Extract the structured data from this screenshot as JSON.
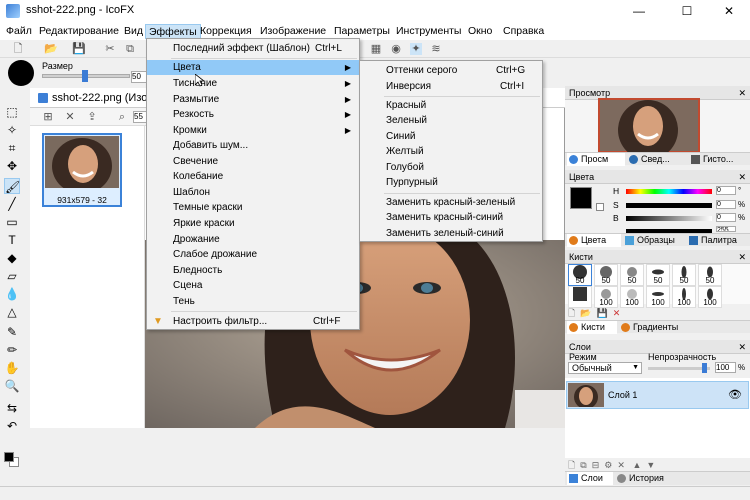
{
  "window": {
    "title": "sshot-222.png - IcoFX",
    "minimize": "—",
    "maximize": "☐",
    "close": "✕"
  },
  "menubar": [
    "Файл",
    "Редактирование",
    "Вид",
    "Эффекты",
    "Коррекция",
    "Изображение",
    "Параметры",
    "Инструменты",
    "Окно",
    "Справка"
  ],
  "options": {
    "size_label": "Размер",
    "size_value": "50",
    "size_fraction": 0.45
  },
  "document": {
    "title": "sshot-222.png (Изоб",
    "zoom_field": "55",
    "thumbnail_label": "931x579 - 32"
  },
  "effects_menu": {
    "items": [
      {
        "label": "Последний эффект (Шаблон)",
        "shortcut": "Ctrl+L"
      },
      {
        "label": "Цвета",
        "submenu": true,
        "highlighted": true
      },
      {
        "label": "Тиснение",
        "submenu": true
      },
      {
        "label": "Размытие",
        "submenu": true
      },
      {
        "label": "Резкость",
        "submenu": true
      },
      {
        "label": "Кромки",
        "submenu": true
      },
      {
        "label": "Добавить шум..."
      },
      {
        "label": "Свечение"
      },
      {
        "label": "Колебание"
      },
      {
        "label": "Шаблон"
      },
      {
        "label": "Темные краски"
      },
      {
        "label": "Яркие краски"
      },
      {
        "label": "Дрожание"
      },
      {
        "label": "Слабое дрожание"
      },
      {
        "label": "Бледность"
      },
      {
        "label": "Сцена"
      },
      {
        "label": "Тень"
      },
      {
        "label": "Настроить фильтр...",
        "shortcut": "Ctrl+F"
      }
    ]
  },
  "colors_submenu": {
    "items": [
      {
        "label": "Оттенки серого",
        "shortcut": "Ctrl+G"
      },
      {
        "label": "Инверсия",
        "shortcut": "Ctrl+I"
      },
      {
        "label": "Красный"
      },
      {
        "label": "Зеленый"
      },
      {
        "label": "Синий"
      },
      {
        "label": "Желтый"
      },
      {
        "label": "Голубой"
      },
      {
        "label": "Пурпурный"
      },
      {
        "label": "Заменить красный-зеленый"
      },
      {
        "label": "Заменить красный-синий"
      },
      {
        "label": "Заменить зеленый-синий"
      }
    ]
  },
  "preview_panel": {
    "title": "Просмотр",
    "tabs": [
      "Просм",
      "Свед...",
      "Гисто..."
    ]
  },
  "colors_panel": {
    "title": "Цвета",
    "channels": [
      {
        "label": "H",
        "value": "0",
        "unit": "°"
      },
      {
        "label": "S",
        "value": "0",
        "unit": "%"
      },
      {
        "label": "B",
        "value": "0",
        "unit": "%"
      },
      {
        "label": "",
        "value": "255",
        "unit": ""
      }
    ],
    "tabs": [
      "Цвета",
      "Образцы",
      "Палитра"
    ]
  },
  "brushes_panel": {
    "title": "Кисти",
    "sizes": [
      "50",
      "50",
      "50",
      "50",
      "50",
      "50",
      "",
      "100",
      "100",
      "100",
      "100",
      "100"
    ],
    "tabs": [
      "Кисти",
      "Градиенты"
    ]
  },
  "layers_panel": {
    "title": "Слои",
    "mode_label": "Режим",
    "opacity_label": "Непрозрачность",
    "mode_value": "Обычный",
    "opacity_value": "100",
    "opacity_unit": "%",
    "layer_name": "Слой 1",
    "tabs": [
      "Слои",
      "История"
    ]
  },
  "colors": {
    "accent": "#91c9f7",
    "selection_border": "#3b82d8"
  }
}
